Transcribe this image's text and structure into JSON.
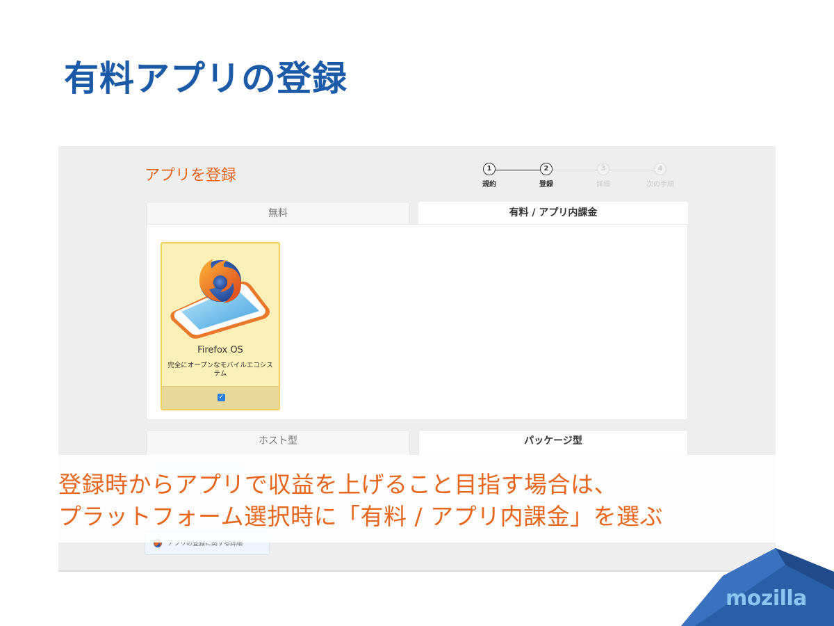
{
  "slide": {
    "title": "有料アプリの登録"
  },
  "screen": {
    "heading": "アプリを登録",
    "stepper": [
      {
        "number": "1",
        "label": "規約",
        "state": "done"
      },
      {
        "number": "2",
        "label": "登録",
        "state": "current"
      },
      {
        "number": "3",
        "label": "詳細",
        "state": "upcoming"
      },
      {
        "number": "4",
        "label": "次の手順",
        "state": "upcoming"
      }
    ],
    "payment_tabs": [
      {
        "label": "無料",
        "selected": false
      },
      {
        "label": "有料 / アプリ内課金",
        "selected": true
      }
    ],
    "platform_card": {
      "name": "Firefox OS",
      "description": "完全にオープンなモバイルエコシステム",
      "checked": true,
      "icon": "firefox-phone-icon"
    },
    "type_tabs": [
      {
        "label": "ホスト型",
        "selected": false
      },
      {
        "label": "パッケージ型",
        "selected": true
      }
    ],
    "help_link": {
      "text": "アプリの登録に関する詳細",
      "icon": "firefox-icon"
    }
  },
  "caption": {
    "line1": "登録時からアプリで収益を上げること目指す場合は、",
    "line2": "プラットフォーム選択時に「有料 / アプリ内課金」を選ぶ"
  },
  "logo": {
    "text": "mozilla"
  },
  "colors": {
    "title_blue": "#1a5aa6",
    "accent_orange": "#e5661c",
    "card_yellow": "#fbf0b8",
    "logo_blue": "#2a5fa8"
  }
}
